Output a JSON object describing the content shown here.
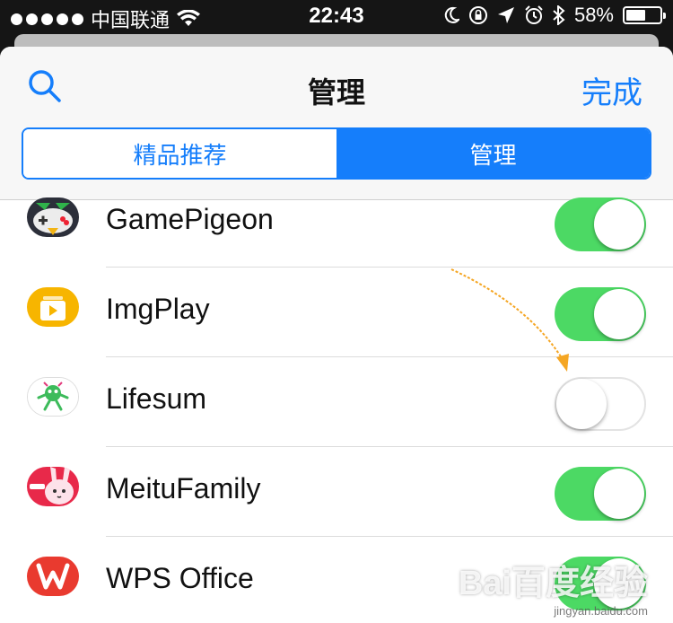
{
  "status_bar": {
    "carrier": "中国联通",
    "time": "22:43",
    "battery_percent": "58%",
    "battery_level": 0.58
  },
  "header": {
    "title": "管理",
    "done_label": "完成",
    "tabs": [
      {
        "label": "精品推荐",
        "selected": false
      },
      {
        "label": "管理",
        "selected": true
      }
    ]
  },
  "apps": [
    {
      "name": "GamePigeon",
      "icon": "gamepigeon-icon",
      "enabled": true
    },
    {
      "name": "ImgPlay",
      "icon": "imgplay-icon",
      "enabled": true
    },
    {
      "name": "Lifesum",
      "icon": "lifesum-icon",
      "enabled": false
    },
    {
      "name": "MeituFamily",
      "icon": "meitufamily-icon",
      "enabled": true
    },
    {
      "name": "WPS Office",
      "icon": "wps-office-icon",
      "enabled": true
    }
  ],
  "watermark": {
    "text": "Bai百度经验",
    "url": "jingyan.baidu.com"
  },
  "colors": {
    "accent": "#157efb",
    "toggle_on": "#4cd964",
    "arrow": "#f5a623"
  }
}
